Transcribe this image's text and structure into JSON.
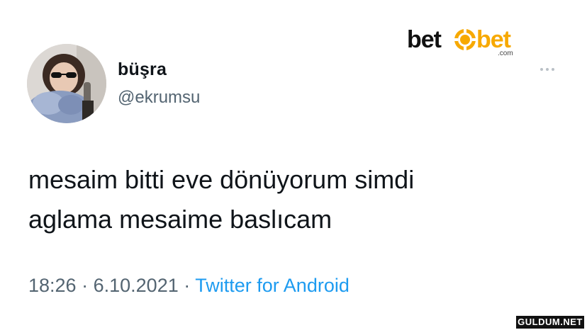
{
  "tweet": {
    "author": {
      "display_name": "büşra",
      "handle": "@ekrumsu"
    },
    "text_lines": [
      "mesaim bitti eve dönüyorum simdi",
      "aglama mesaime baslıcam"
    ],
    "time": "18:26",
    "separator": "·",
    "date": "6.10.2021",
    "source": "Twitter for Android",
    "more_icon": "more-horizontal-icon"
  },
  "sponsor_logo": {
    "part1": "bet",
    "part2": "bet",
    "suffix": ".com",
    "colors": {
      "dark": "#111111",
      "accent": "#f7a900"
    }
  },
  "watermark": {
    "text": "GULDUM.NET"
  },
  "colors": {
    "text_primary": "#0f1419",
    "text_secondary": "#536471",
    "link": "#1d9bf0",
    "background": "#ffffff"
  }
}
